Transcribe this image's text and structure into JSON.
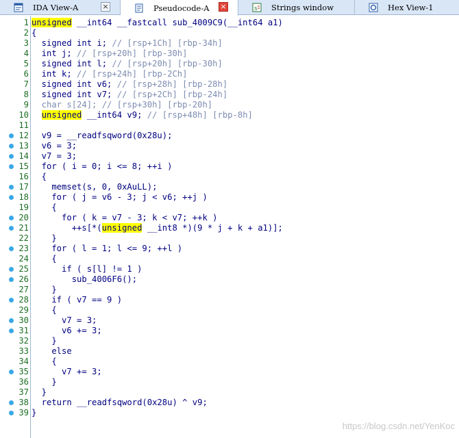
{
  "tabs": [
    {
      "label": "IDA View-A",
      "icon": "ida-view-icon",
      "active": false
    },
    {
      "label": "Pseudocode-A",
      "icon": "pseudocode-icon",
      "active": true
    },
    {
      "label": "Strings window",
      "icon": "strings-icon",
      "active": false
    },
    {
      "label": "Hex View-1",
      "icon": "hex-view-icon",
      "active": false
    }
  ],
  "close_glyph": "×",
  "lines": [
    {
      "n": "1",
      "dot": false,
      "segs": [
        [
          "hl",
          "unsigned"
        ],
        [
          "t",
          " __int64 __fastcall sub_4009C9(__int64 a1)"
        ]
      ]
    },
    {
      "n": "2",
      "dot": false,
      "segs": [
        [
          "t",
          "{"
        ]
      ]
    },
    {
      "n": "3",
      "dot": false,
      "segs": [
        [
          "t",
          "  signed int i; "
        ],
        [
          "c",
          "// [rsp+1Ch] [rbp-34h]"
        ]
      ]
    },
    {
      "n": "4",
      "dot": false,
      "segs": [
        [
          "t",
          "  int j; "
        ],
        [
          "c",
          "// [rsp+20h] [rbp-30h]"
        ]
      ]
    },
    {
      "n": "5",
      "dot": false,
      "segs": [
        [
          "t",
          "  signed int l; "
        ],
        [
          "c",
          "// [rsp+20h] [rbp-30h]"
        ]
      ]
    },
    {
      "n": "6",
      "dot": false,
      "segs": [
        [
          "t",
          "  int k; "
        ],
        [
          "c",
          "// [rsp+24h] [rbp-2Ch]"
        ]
      ]
    },
    {
      "n": "7",
      "dot": false,
      "segs": [
        [
          "t",
          "  signed int v6; "
        ],
        [
          "c",
          "// [rsp+28h] [rbp-28h]"
        ]
      ]
    },
    {
      "n": "8",
      "dot": false,
      "segs": [
        [
          "t",
          "  signed int v7; "
        ],
        [
          "c",
          "// [rsp+2Ch] [rbp-24h]"
        ]
      ]
    },
    {
      "n": "9",
      "dot": false,
      "segs": [
        [
          "c",
          "  char s[24]; // [rsp+30h] [rbp-20h]"
        ]
      ]
    },
    {
      "n": "10",
      "dot": false,
      "segs": [
        [
          "t",
          "  "
        ],
        [
          "hl",
          "unsigned"
        ],
        [
          "t",
          " __int64 v9; "
        ],
        [
          "c",
          "// [rsp+48h] [rbp-8h]"
        ]
      ]
    },
    {
      "n": "11",
      "dot": false,
      "segs": [
        [
          "t",
          ""
        ]
      ]
    },
    {
      "n": "12",
      "dot": true,
      "segs": [
        [
          "t",
          "  v9 = __readfsqword(0x28u);"
        ]
      ]
    },
    {
      "n": "13",
      "dot": true,
      "segs": [
        [
          "t",
          "  v6 = 3;"
        ]
      ]
    },
    {
      "n": "14",
      "dot": true,
      "segs": [
        [
          "t",
          "  v7 = 3;"
        ]
      ]
    },
    {
      "n": "15",
      "dot": true,
      "segs": [
        [
          "t",
          "  for ( i = 0; i <= 8; ++i )"
        ]
      ]
    },
    {
      "n": "16",
      "dot": false,
      "segs": [
        [
          "t",
          "  {"
        ]
      ]
    },
    {
      "n": "17",
      "dot": true,
      "segs": [
        [
          "t",
          "    memset(s, 0, 0xAuLL);"
        ]
      ]
    },
    {
      "n": "18",
      "dot": true,
      "segs": [
        [
          "t",
          "    for ( j = v6 - 3; j < v6; ++j )"
        ]
      ]
    },
    {
      "n": "19",
      "dot": false,
      "segs": [
        [
          "t",
          "    {"
        ]
      ]
    },
    {
      "n": "20",
      "dot": true,
      "segs": [
        [
          "t",
          "      for ( k = v7 - 3; k < v7; ++k )"
        ]
      ]
    },
    {
      "n": "21",
      "dot": true,
      "segs": [
        [
          "t",
          "        ++s[*("
        ],
        [
          "hl",
          "unsigned"
        ],
        [
          "t",
          " __int8 *)(9 * j + k + a1)];"
        ]
      ]
    },
    {
      "n": "22",
      "dot": false,
      "segs": [
        [
          "t",
          "    }"
        ]
      ]
    },
    {
      "n": "23",
      "dot": true,
      "segs": [
        [
          "t",
          "    for ( l = 1; l <= 9; ++l )"
        ]
      ]
    },
    {
      "n": "24",
      "dot": false,
      "segs": [
        [
          "t",
          "    {"
        ]
      ]
    },
    {
      "n": "25",
      "dot": true,
      "segs": [
        [
          "t",
          "      if ( s[l] != 1 )"
        ]
      ]
    },
    {
      "n": "26",
      "dot": true,
      "segs": [
        [
          "t",
          "        sub_4006F6();"
        ]
      ]
    },
    {
      "n": "27",
      "dot": false,
      "segs": [
        [
          "t",
          "    }"
        ]
      ]
    },
    {
      "n": "28",
      "dot": true,
      "segs": [
        [
          "t",
          "    if ( v7 == 9 )"
        ]
      ]
    },
    {
      "n": "29",
      "dot": false,
      "segs": [
        [
          "t",
          "    {"
        ]
      ]
    },
    {
      "n": "30",
      "dot": true,
      "segs": [
        [
          "t",
          "      v7 = 3;"
        ]
      ]
    },
    {
      "n": "31",
      "dot": true,
      "segs": [
        [
          "t",
          "      v6 += 3;"
        ]
      ]
    },
    {
      "n": "32",
      "dot": false,
      "segs": [
        [
          "t",
          "    }"
        ]
      ]
    },
    {
      "n": "33",
      "dot": false,
      "segs": [
        [
          "t",
          "    else"
        ]
      ]
    },
    {
      "n": "34",
      "dot": false,
      "segs": [
        [
          "t",
          "    {"
        ]
      ]
    },
    {
      "n": "35",
      "dot": true,
      "segs": [
        [
          "t",
          "      v7 += 3;"
        ]
      ]
    },
    {
      "n": "36",
      "dot": false,
      "segs": [
        [
          "t",
          "    }"
        ]
      ]
    },
    {
      "n": "37",
      "dot": false,
      "segs": [
        [
          "t",
          "  }"
        ]
      ]
    },
    {
      "n": "38",
      "dot": true,
      "segs": [
        [
          "t",
          "  return __readfsqword(0x28u) ^ v9;"
        ]
      ]
    },
    {
      "n": "39",
      "dot": true,
      "segs": [
        [
          "t",
          "}"
        ]
      ]
    }
  ],
  "watermark": "https://blog.csdn.net/YenKoc",
  "colors": {
    "code": "#000080",
    "comment": "#7d8cb0",
    "highlight": "#ffff00",
    "line_number": "#1c6e25",
    "breakpoint_dot": "#3aa8e8",
    "tabbar": "#d9e6f6"
  }
}
